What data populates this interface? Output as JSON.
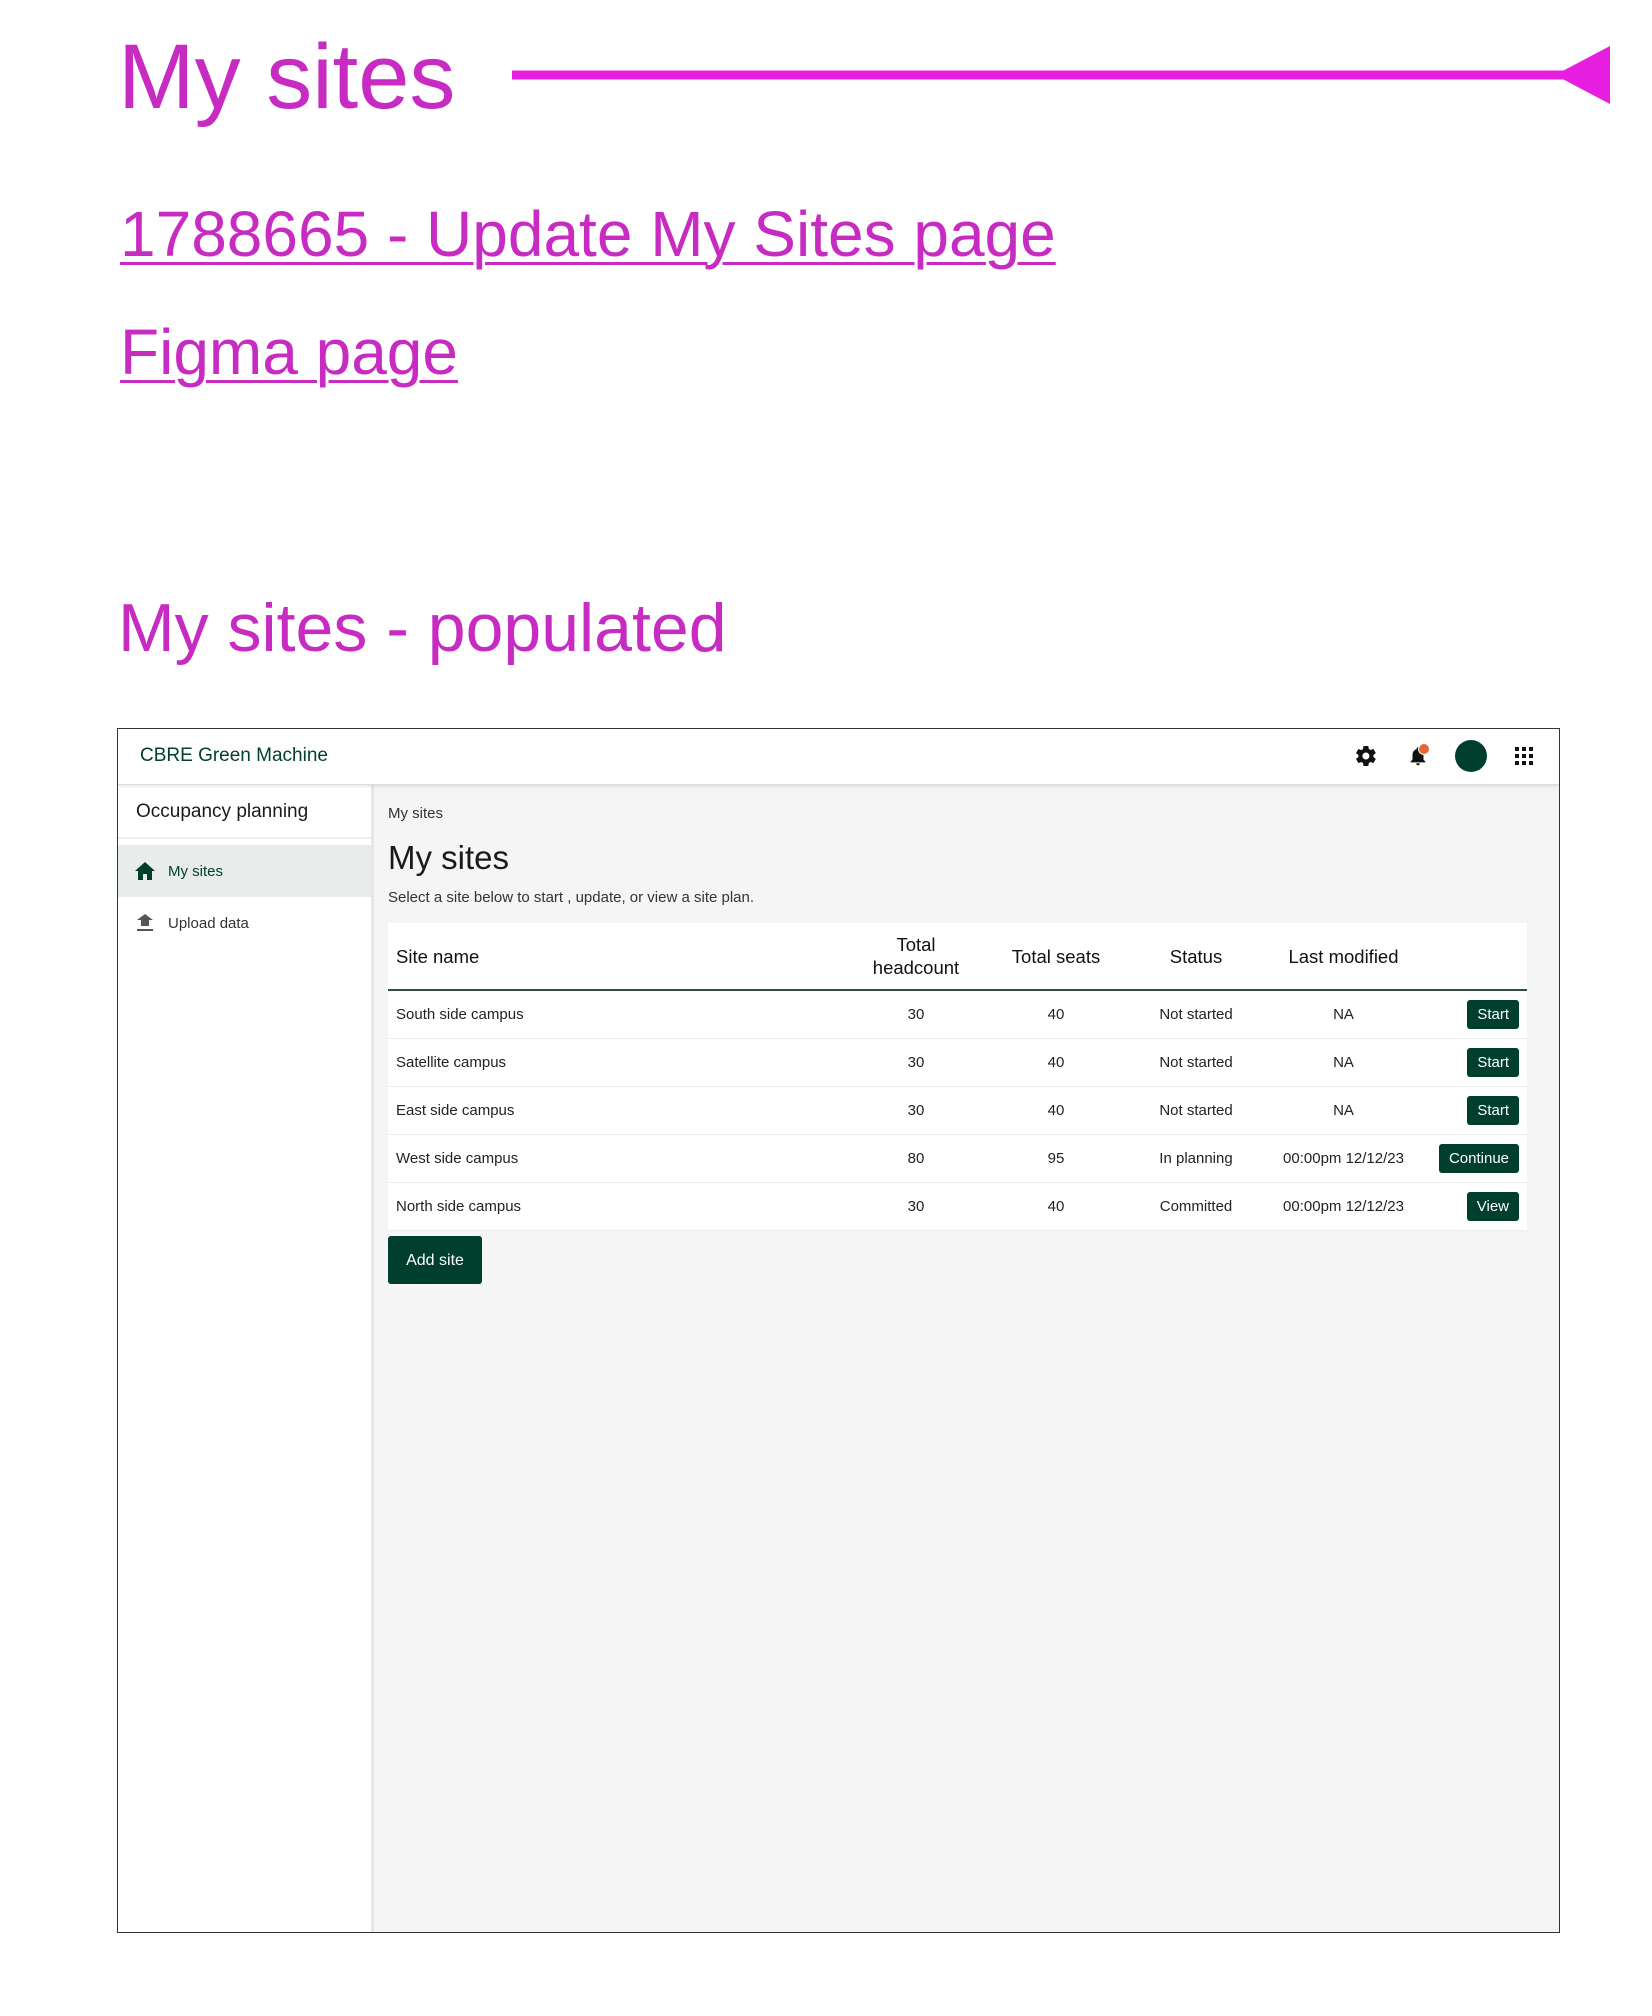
{
  "annotations": {
    "title": "My sites",
    "link_ticket": "1788665 - Update My Sites page",
    "link_figma": "Figma page",
    "subtitle": "My sites - populated",
    "color": "#c72bc1"
  },
  "app": {
    "brand": "CBRE Green Machine",
    "top_icons": [
      "gear-icon",
      "bell-icon",
      "avatar",
      "apps-grid-icon"
    ],
    "accent": "#003f2d"
  },
  "sidebar": {
    "title": "Occupancy planning",
    "items": [
      {
        "label": "My sites",
        "icon": "home-icon",
        "active": true
      },
      {
        "label": "Upload data",
        "icon": "upload-icon",
        "active": false
      }
    ]
  },
  "main": {
    "breadcrumb": "My sites",
    "title": "My sites",
    "description": "Select a site below to start , update, or view a site plan.",
    "table": {
      "headers": [
        "Site name",
        "Total headcount",
        "Total seats",
        "Status",
        "Last modified",
        ""
      ],
      "header_headcount_line1": "Total",
      "header_headcount_line2": "headcount",
      "rows": [
        {
          "name": "South side campus",
          "headcount": "30",
          "seats": "40",
          "status": "Not started",
          "modified": "NA",
          "action": "Start"
        },
        {
          "name": "Satellite campus",
          "headcount": "30",
          "seats": "40",
          "status": "Not started",
          "modified": "NA",
          "action": "Start"
        },
        {
          "name": "East side campus",
          "headcount": "30",
          "seats": "40",
          "status": "Not started",
          "modified": "NA",
          "action": "Start"
        },
        {
          "name": "West side campus",
          "headcount": "80",
          "seats": "95",
          "status": "In planning",
          "modified": "00:00pm 12/12/23",
          "action": "Continue"
        },
        {
          "name": "North side campus",
          "headcount": "30",
          "seats": "40",
          "status": "Committed",
          "modified": "00:00pm 12/12/23",
          "action": "View"
        }
      ]
    },
    "add_button": "Add site"
  }
}
